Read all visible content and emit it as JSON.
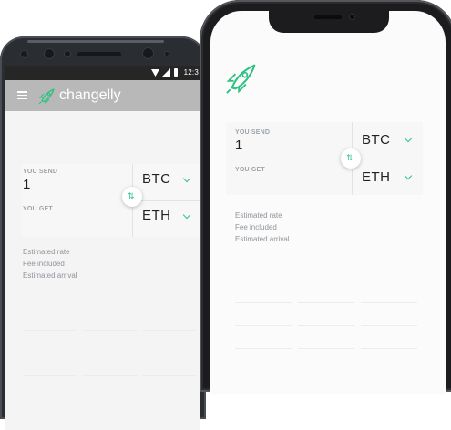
{
  "android": {
    "status_time": "12:3",
    "brand": "changelly",
    "you_send_label": "YOU SEND",
    "send_amount": "1",
    "send_coin": "BTC",
    "you_get_label": "YOU GET",
    "get_coin": "ETH",
    "estimated_rate_label": "Estimated rate",
    "fee_included_label": "Fee included",
    "estimated_arrival_label": "Estimated arrival"
  },
  "iphone": {
    "you_send_label": "YOU SEND",
    "send_amount": "1",
    "send_coin": "BTC",
    "you_get_label": "YOU GET",
    "get_coin": "ETH",
    "estimated_rate_label": "Estimated rate",
    "fee_included_label": "Fee included",
    "estimated_arrival_label": "Estimated arrival"
  },
  "colors": {
    "accent": "#30c28a",
    "toolbar": "#b8b8b8",
    "label": "#9ea4aa"
  },
  "icons": {
    "menu": "hamburger-icon",
    "logo": "rocket-icon",
    "swap": "swap-arrows-icon",
    "dropdown": "chevron-down-icon"
  }
}
